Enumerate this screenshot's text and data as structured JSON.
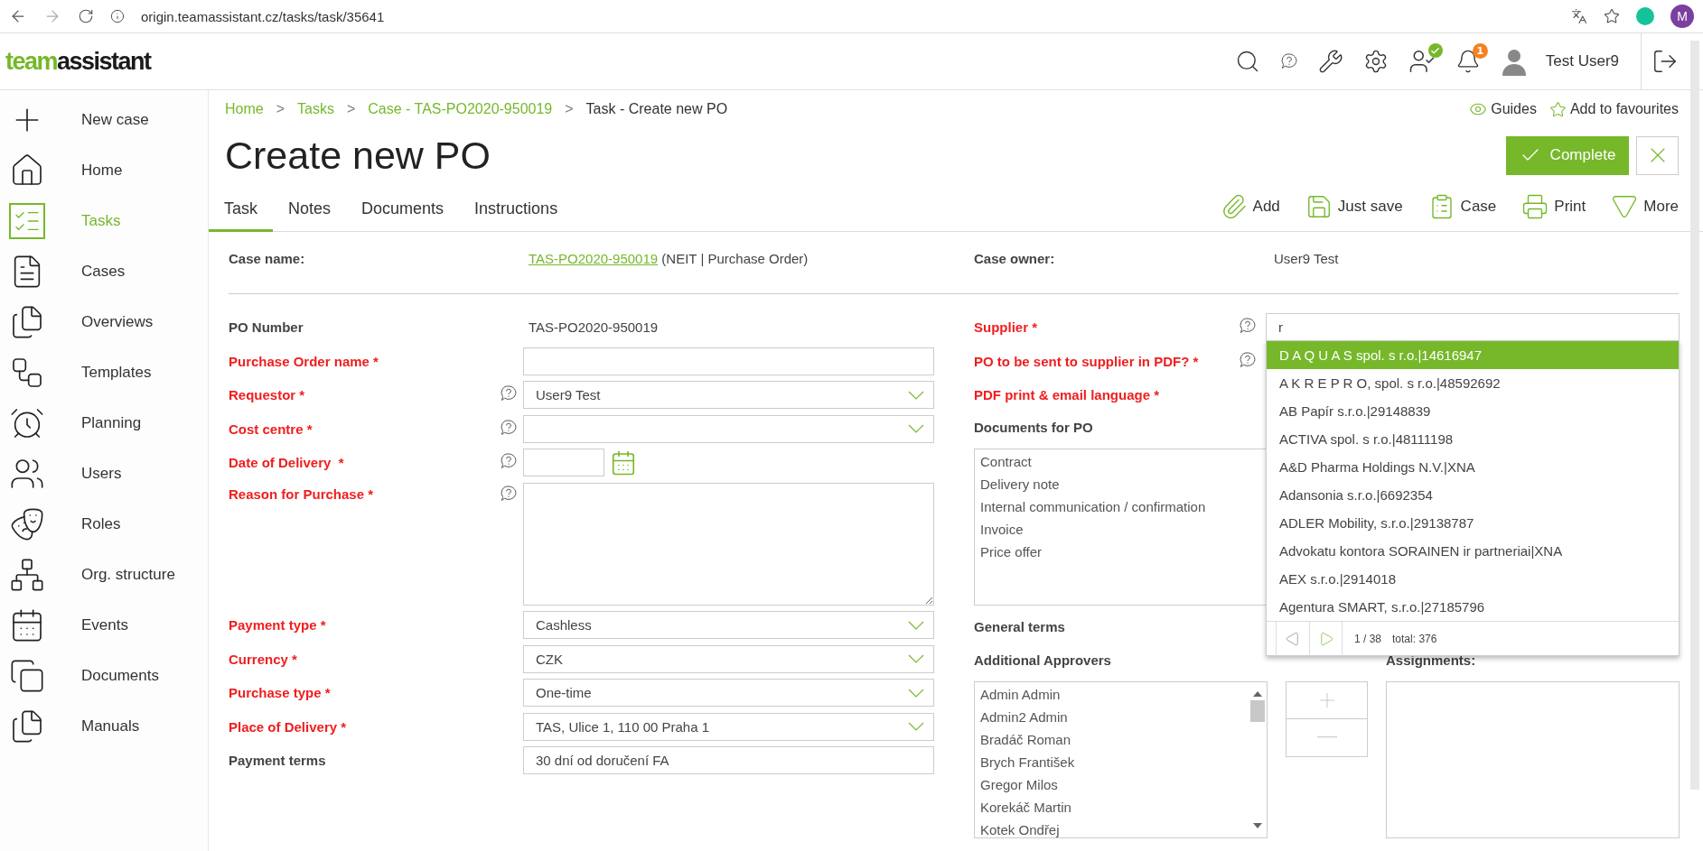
{
  "browser": {
    "url": "origin.teamassistant.cz/tasks/task/35641",
    "profile_initial": "M"
  },
  "header": {
    "logo": [
      "team",
      "assistant"
    ],
    "notification_count": "1",
    "user_name": "Test User9"
  },
  "sidebar": {
    "items": [
      {
        "label": "New case",
        "selected": false
      },
      {
        "label": "Home",
        "selected": false
      },
      {
        "label": "Tasks",
        "selected": true
      },
      {
        "label": "Cases",
        "selected": false
      },
      {
        "label": "Overviews",
        "selected": false
      },
      {
        "label": "Templates",
        "selected": false
      },
      {
        "label": "Planning",
        "selected": false
      },
      {
        "label": "Users",
        "selected": false
      },
      {
        "label": "Roles",
        "selected": false
      },
      {
        "label": "Org. structure",
        "selected": false
      },
      {
        "label": "Events",
        "selected": false
      },
      {
        "label": "Documents",
        "selected": false
      },
      {
        "label": "Manuals",
        "selected": false
      }
    ]
  },
  "breadcrumbs": [
    {
      "label": "Home",
      "link": true
    },
    {
      "label": "Tasks",
      "link": true,
      "separator": ">"
    },
    {
      "label": "Case - TAS-PO2020-950019",
      "link": true,
      "separator": ">"
    },
    {
      "label": "Task - Create new PO",
      "link": false,
      "separator": ">"
    }
  ],
  "page_links": {
    "guides": "Guides",
    "favourites": "Add to favourites"
  },
  "title": "Create new PO",
  "complete_button": "Complete",
  "tabs": [
    {
      "label": "Task",
      "selected": true
    },
    {
      "label": "Notes",
      "selected": false
    },
    {
      "label": "Documents",
      "selected": false
    },
    {
      "label": "Instructions",
      "selected": false
    }
  ],
  "toolbar": [
    "Add",
    "Just save",
    "Case",
    "Print",
    "More"
  ],
  "case_info": [
    {
      "label": "Case name:",
      "link": "TAS-PO2020-950019",
      "value": "(NEIT | Purchase Order)"
    },
    {
      "label": "Case owner:",
      "value": "User9 Test"
    }
  ],
  "left_fields": [
    {
      "label": "PO Number",
      "required": false,
      "kind": "static",
      "value": "TAS-PO2020-950019"
    },
    {
      "label": "Purchase Order name *",
      "required": true,
      "kind": "text"
    },
    {
      "label": "Requestor *",
      "required": true,
      "help": true,
      "kind": "select",
      "value": "User9 Test"
    },
    {
      "label": "Cost centre *",
      "required": true,
      "help": true,
      "kind": "select"
    },
    {
      "label": "Date of Delivery  *",
      "required": true,
      "help": true,
      "kind": "date"
    },
    {
      "label": "Reason for Purchase *",
      "required": true,
      "help": true,
      "kind": "textarea"
    },
    {
      "label": "Payment type *",
      "required": true,
      "kind": "select",
      "value": "Cashless"
    },
    {
      "label": "Currency *",
      "required": true,
      "kind": "select",
      "value": "CZK"
    },
    {
      "label": "Purchase type *",
      "required": true,
      "kind": "select",
      "value": "One-time"
    },
    {
      "label": "Place of Delivery *",
      "required": true,
      "kind": "select",
      "value": "TAS, Ulice 1, 110 00 Praha 1"
    },
    {
      "label": "Payment terms",
      "required": false,
      "kind": "text",
      "value": "30 dní od doručení FA"
    }
  ],
  "right_fields": [
    {
      "label": "Supplier *",
      "required": true,
      "help": true,
      "kind": "search",
      "value": "r"
    },
    {
      "label": "PO to be sent to supplier in PDF? *",
      "required": true,
      "help": true,
      "kind": "hidden"
    },
    {
      "label": "PDF print & email language *",
      "required": true,
      "kind": "hidden"
    }
  ],
  "supplier_dropdown": {
    "options": [
      {
        "label": "D A Q U A S spol. s r.o.|14616947",
        "selected": true
      },
      {
        "label": "A K R E P R O, spol. s r.o.|48592692",
        "selected": false
      },
      {
        "label": "AB Papír s.r.o.|29148839",
        "selected": false
      },
      {
        "label": "ACTIVA spol. s r.o.|48111198",
        "selected": false
      },
      {
        "label": "A&D Pharma Holdings N.V.|XNA",
        "selected": false
      },
      {
        "label": "Adansonia s.r.o.|6692354",
        "selected": false
      },
      {
        "label": "ADLER Mobility, s.r.o.|29138787",
        "selected": false
      },
      {
        "label": "Advokatu kontora SORAINEN ir partneriai|XNA",
        "selected": false
      },
      {
        "label": "AEX s.r.o.|2914018",
        "selected": false
      },
      {
        "label": "Agentura SMART, s.r.o.|27185796",
        "selected": false
      }
    ],
    "page": "1 / 38",
    "total": "total: 376"
  },
  "documents": {
    "label": "Documents for PO",
    "items": [
      "Contract",
      "Delivery note",
      "Internal communication / confirmation",
      "Invoice",
      "Price offer"
    ]
  },
  "general_terms": "General terms",
  "approvers": {
    "label": "Additional Approvers",
    "items": [
      "Admin Admin",
      "Admin2 Admin",
      "Bradáč Roman",
      "Brych František",
      "Gregor Milos",
      "Korekáč Martin",
      "Kotek Ondřej"
    ]
  },
  "assignments": {
    "label": "Assignments:"
  }
}
